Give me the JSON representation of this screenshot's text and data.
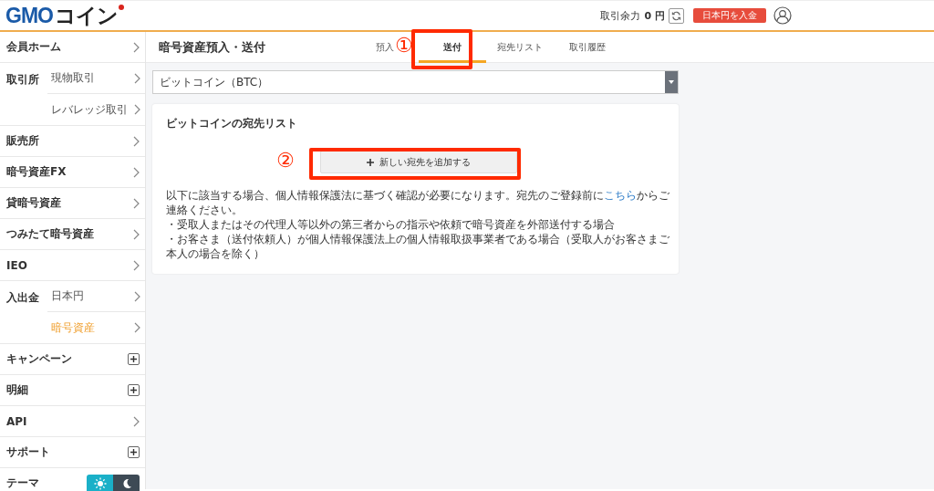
{
  "header": {
    "logo": {
      "brand": "GMO",
      "suffix": "コイン"
    },
    "balance_label": "取引余力",
    "balance_value": "0 円",
    "deposit_button": "日本円を入金"
  },
  "sidebar": {
    "items": [
      {
        "label": "会員ホーム",
        "kind": "chevron"
      },
      {
        "label": "取引所",
        "kind": "group",
        "children": [
          {
            "label": "現物取引",
            "selected": false
          },
          {
            "label": "レバレッジ取引",
            "selected": false
          }
        ]
      },
      {
        "label": "販売所",
        "kind": "chevron"
      },
      {
        "label": "暗号資産FX",
        "kind": "chevron"
      },
      {
        "label": "貸暗号資産",
        "kind": "chevron"
      },
      {
        "label": "つみたて暗号資産",
        "kind": "chevron"
      },
      {
        "label": "IEO",
        "kind": "chevron"
      },
      {
        "label": "入出金",
        "kind": "group",
        "children": [
          {
            "label": "日本円",
            "selected": false
          },
          {
            "label": "暗号資産",
            "selected": true
          }
        ]
      },
      {
        "label": "キャンペーン",
        "kind": "expand"
      },
      {
        "label": "明細",
        "kind": "expand"
      },
      {
        "label": "API",
        "kind": "chevron"
      },
      {
        "label": "サポート",
        "kind": "expand"
      },
      {
        "label": "テーマ",
        "kind": "theme",
        "options": [
          {
            "kind": "sun",
            "selected": true
          },
          {
            "kind": "moon",
            "selected": false
          }
        ]
      }
    ]
  },
  "page": {
    "title": "暗号資産預入・送付",
    "tabs": [
      {
        "label": "預入",
        "selected": false
      },
      {
        "label": "送付",
        "selected": true,
        "annotation": "①"
      },
      {
        "label": "宛先リスト",
        "selected": false
      },
      {
        "label": "取引履歴",
        "selected": false
      }
    ],
    "currency_select": {
      "value": "ビットコイン（BTC）"
    },
    "card": {
      "title": "ビットコインの宛先リスト",
      "add_button": "新しい宛先を追加する",
      "add_button_annotation": "②",
      "notice": {
        "before": "以下に該当する場合、個人情報保護法に基づく確認が必要になります。宛先のご登録前に",
        "link": "こちら",
        "after": "からご連絡ください。"
      },
      "conditions": [
        "・受取人またはその代理人等以外の第三者からの指示や依頼で暗号資産を外部送付する場合",
        "・お客さま（送付依頼人）が個人情報保護法上の個人情報取扱事業者である場合（受取人がお客さまご本人の場合を除く）"
      ]
    }
  }
}
